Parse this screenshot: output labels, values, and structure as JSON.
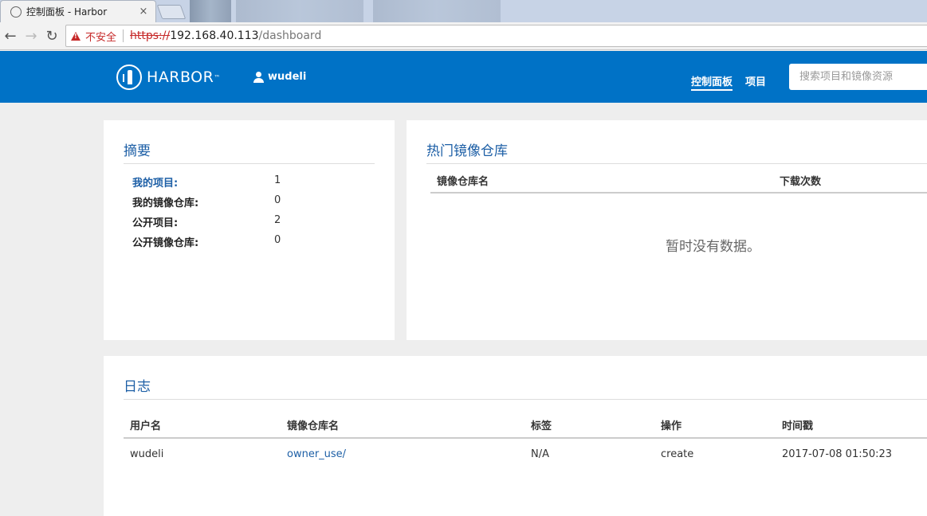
{
  "browser": {
    "tab_title": "控制面板 - Harbor",
    "tab_close": "×",
    "security_label": "不安全",
    "url_scheme": "https://",
    "url_host": "192.168.40.113",
    "url_path": "/dashboard"
  },
  "header": {
    "logo_text": "HARBOR",
    "logo_tm": "™",
    "username": "wudeli",
    "nav": {
      "dashboard": "控制面板",
      "projects": "项目"
    },
    "search_placeholder": "搜索项目和镜像资源"
  },
  "summary": {
    "title": "摘要",
    "rows": [
      {
        "label": "我的项目:",
        "value": "1"
      },
      {
        "label": "我的镜像仓库:",
        "value": "0"
      },
      {
        "label": "公开项目:",
        "value": "2"
      },
      {
        "label": "公开镜像仓库:",
        "value": "0"
      }
    ]
  },
  "popular": {
    "title": "热门镜像仓库",
    "columns": [
      "镜像仓库名",
      "下载次数"
    ],
    "empty_message": "暂时没有数据。"
  },
  "logs": {
    "title": "日志",
    "columns": [
      "用户名",
      "镜像仓库名",
      "标签",
      "操作",
      "时间戳"
    ],
    "rows": [
      {
        "username": "wudeli",
        "repository": "owner_use/",
        "tag": "N/A",
        "operation": "create",
        "timestamp": "2017-07-08 01:50:23"
      }
    ]
  },
  "colors": {
    "header_bg": "#0072c6",
    "link": "#1d5fa6",
    "insecure": "#c62828"
  }
}
